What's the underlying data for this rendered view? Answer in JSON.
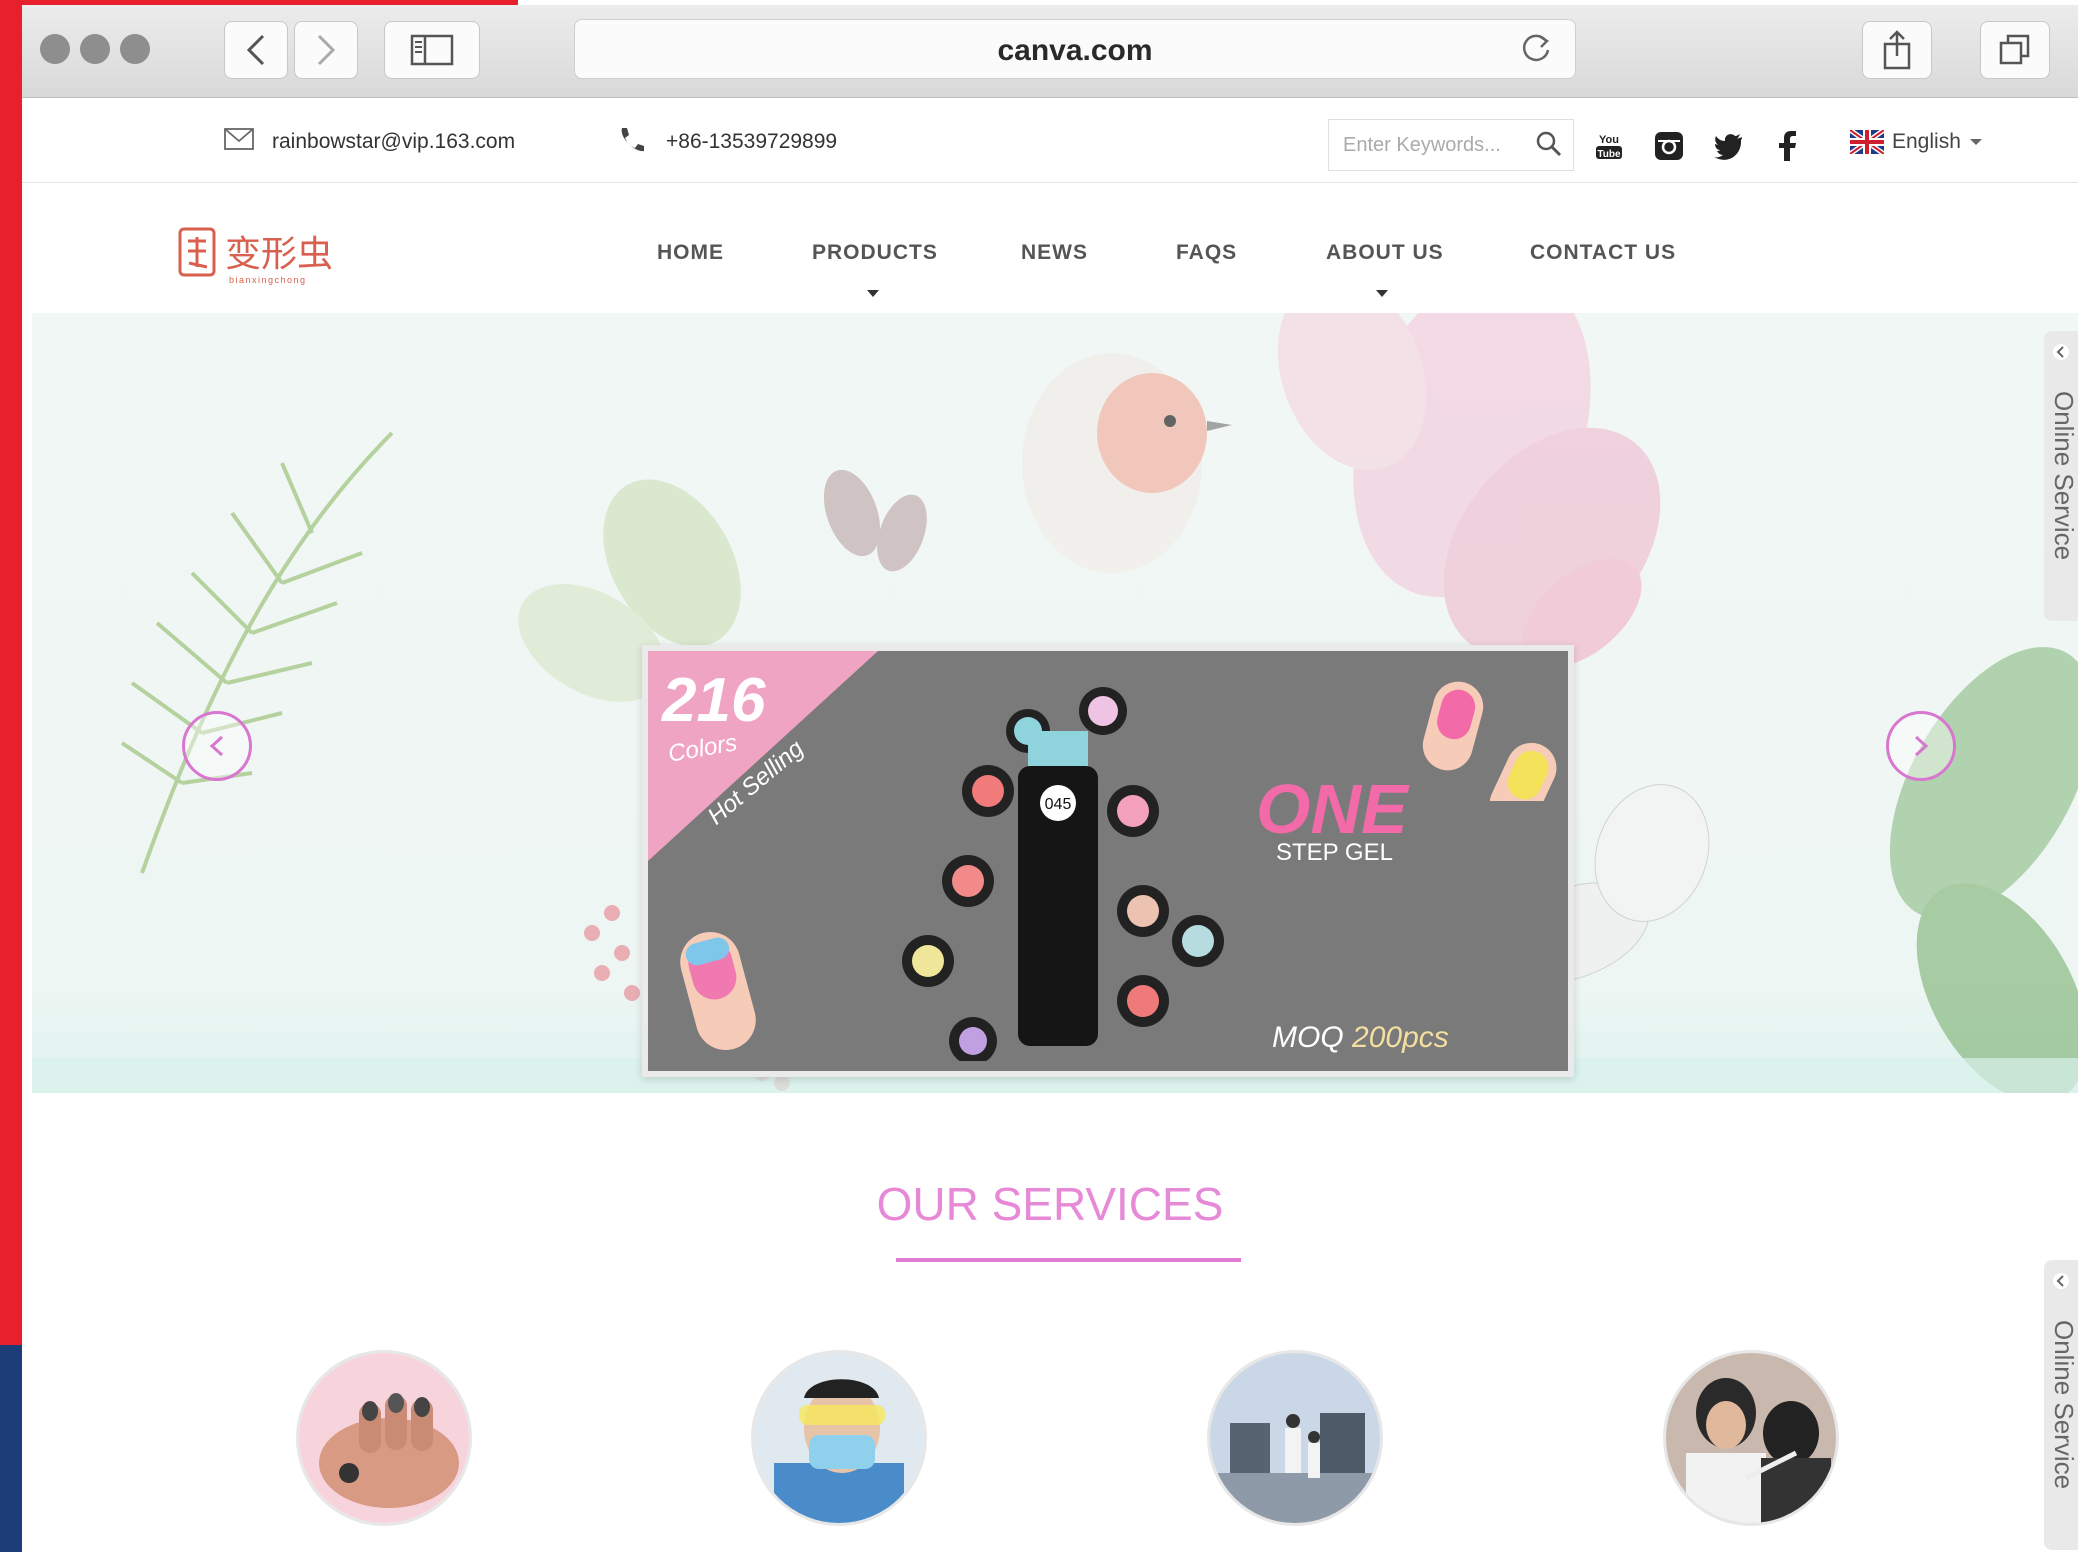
{
  "browser": {
    "url": "canva.com"
  },
  "topbar": {
    "email": "rainbowstar@vip.163.com",
    "phone": "+86-13539729899",
    "search_placeholder": "Enter Keywords...",
    "language": "English"
  },
  "brand": {
    "logo_text": "变形虫",
    "logo_sub": "bianxingchong"
  },
  "nav": {
    "items": [
      "HOME",
      "PRODUCTS",
      "NEWS",
      "FAQS",
      "ABOUT US",
      "CONTACT US"
    ]
  },
  "hero": {
    "badge_number": "216",
    "badge_line1": "Colors",
    "badge_line2": "Hot Selling",
    "headline": "ONE",
    "subheadline": "STEP GEL",
    "moq_label": "MOQ",
    "moq_value": "200pcs",
    "bottle_label": "045"
  },
  "side_widget": {
    "label": "Online Service"
  },
  "services": {
    "title": "OUR SERVICES"
  },
  "icons": {
    "mail": "mail-icon",
    "phone": "phone-icon",
    "search": "search-icon",
    "youtube": "youtube-icon",
    "instagram": "instagram-icon",
    "twitter": "twitter-icon",
    "facebook": "facebook-icon",
    "flag": "uk-flag-icon"
  },
  "colors": {
    "accent_pink": "#e68ad8",
    "arrow_pink": "#d876d0",
    "logo_red": "#d9604f"
  }
}
